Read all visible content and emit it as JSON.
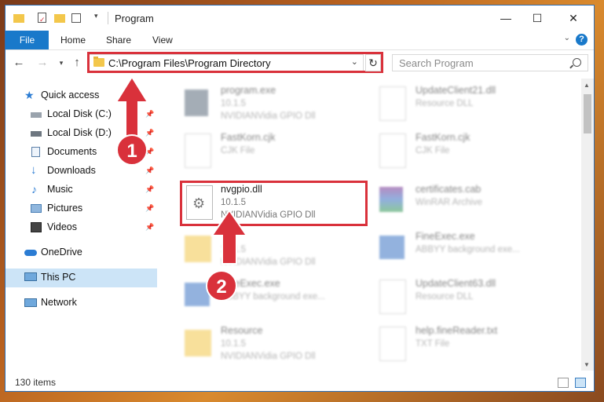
{
  "window": {
    "title": "Program",
    "controls": {
      "minimize": "—",
      "maximize": "☐",
      "close": "✕"
    }
  },
  "ribbon": {
    "tabs": [
      {
        "label": "File",
        "active": true
      },
      {
        "label": "Home"
      },
      {
        "label": "Share"
      },
      {
        "label": "View"
      }
    ],
    "help_label": "?"
  },
  "address_bar": {
    "path": "C:\\Program Files\\Program Directory",
    "search_placeholder": "Search Program"
  },
  "navigation": {
    "items": [
      {
        "label": "Quick access",
        "icon": "star-icon",
        "pinned": false
      },
      {
        "label": "Local Disk (C:)",
        "icon": "drive-icon",
        "pinned": true
      },
      {
        "label": "Local Disk (D:)",
        "icon": "drive-icon",
        "pinned": true
      },
      {
        "label": "Documents",
        "icon": "documents-icon",
        "pinned": true
      },
      {
        "label": "Downloads",
        "icon": "download-icon",
        "pinned": true
      },
      {
        "label": "Music",
        "icon": "music-icon",
        "pinned": true
      },
      {
        "label": "Pictures",
        "icon": "pictures-icon",
        "pinned": true
      },
      {
        "label": "Videos",
        "icon": "videos-icon",
        "pinned": true
      },
      {
        "label": "OneDrive",
        "icon": "cloud-icon",
        "pinned": false
      },
      {
        "label": "This PC",
        "icon": "computer-icon",
        "pinned": false,
        "selected": true
      },
      {
        "label": "Network",
        "icon": "network-icon",
        "pinned": false
      }
    ]
  },
  "files": [
    {
      "name": "program.exe",
      "line1": "10.1.5",
      "line2": "NVIDIANVidia GPIO Dll",
      "icon": "exe-icon",
      "blurred": true
    },
    {
      "name": "UpdateClient21.dll",
      "line1": "Resource DLL",
      "line2": "",
      "icon": "dll-icon",
      "blurred": true
    },
    {
      "name": "FastKorn.cjk",
      "line1": "CJK File",
      "line2": "",
      "icon": "document-icon",
      "blurred": true
    },
    {
      "name": "FastKorn.cjk",
      "line1": "CJK File",
      "line2": "",
      "icon": "document-icon",
      "blurred": true
    },
    {
      "name": "nvgpio.dll",
      "line1": "10.1.5",
      "line2": "NVIDIANVidia GPIO Dll",
      "icon": "dll-gear-icon",
      "blurred": false,
      "highlighted": true
    },
    {
      "name": "certificates.cab",
      "line1": "WinRAR Archive",
      "line2": "",
      "icon": "archive-icon",
      "blurred": true
    },
    {
      "name": "",
      "line1": "10.1.5",
      "line2": "NVIDIANVidia GPIO Dll",
      "icon": "folder-icon",
      "blurred": true
    },
    {
      "name": "FineExec.exe",
      "line1": "ABBYY background exe...",
      "line2": "",
      "icon": "exe-icon",
      "blurred": true
    },
    {
      "name": "FineExec.exe",
      "line1": "ABBYY background exe...",
      "line2": "",
      "icon": "exe-icon",
      "blurred": true
    },
    {
      "name": "UpdateClient63.dll",
      "line1": "Resource DLL",
      "line2": "",
      "icon": "dll-icon",
      "blurred": true
    },
    {
      "name": "Resource",
      "line1": "10.1.5",
      "line2": "NVIDIANVidia GPIO Dll",
      "icon": "folder-icon",
      "blurred": true
    },
    {
      "name": "help.fineReader.txt",
      "line1": "TXT File",
      "line2": "",
      "icon": "document-icon",
      "blurred": true
    }
  ],
  "annotations": {
    "step1": "1",
    "step2": "2",
    "color": "#d9313b"
  },
  "status": {
    "item_count": "130 items"
  }
}
